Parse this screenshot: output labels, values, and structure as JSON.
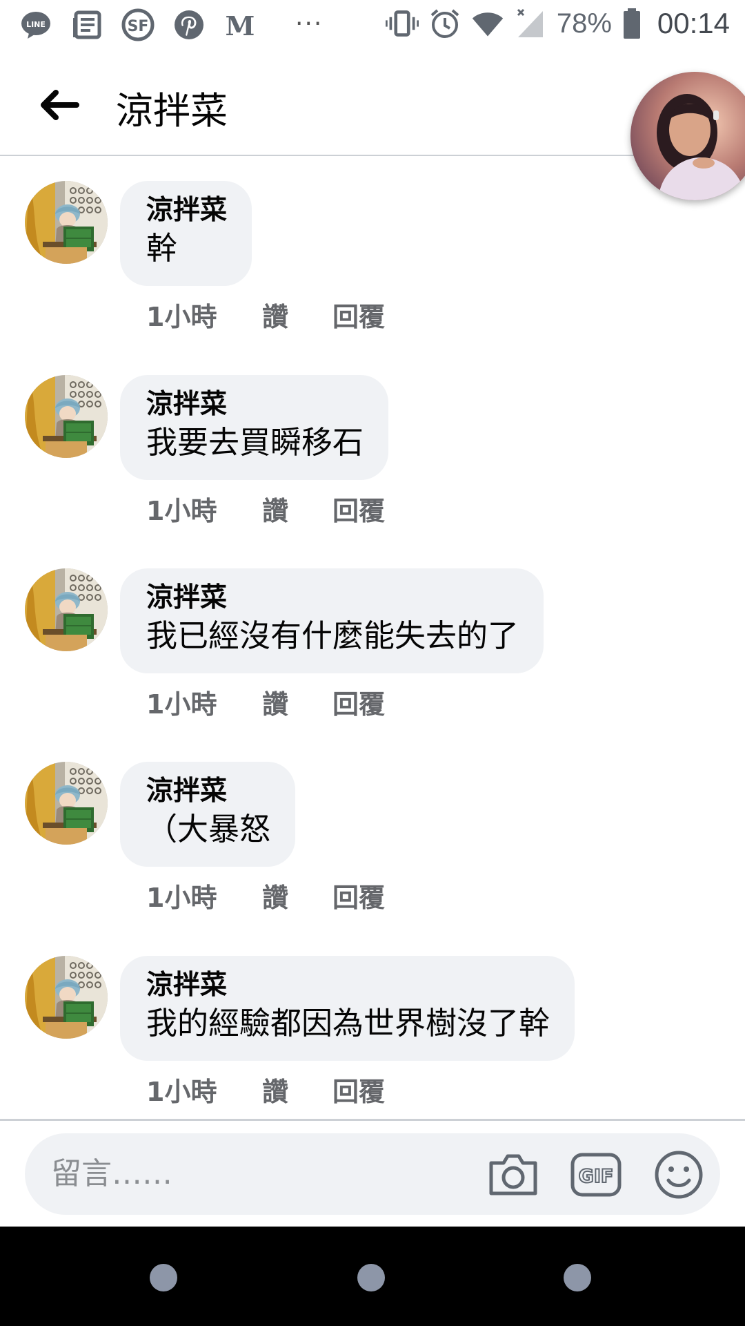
{
  "status_bar": {
    "left_icons": [
      "line-icon",
      "news-icon",
      "sf-icon",
      "pinterest-icon",
      "medium-icon"
    ],
    "line_icon_text": "LINE",
    "sf_icon_text": "SF",
    "medium_icon_text": "M",
    "more_dots": "···",
    "right_icons": [
      "vibrate-icon",
      "alarm-icon",
      "wifi-icon",
      "signal-icon",
      "battery-icon"
    ],
    "battery_percent": "78%",
    "time": "00:14"
  },
  "header": {
    "title": "涼拌菜",
    "back_icon": "arrow-left-icon"
  },
  "comments": [
    {
      "author": "涼拌菜",
      "text": "幹",
      "time": "1小時",
      "like": "讚",
      "reply": "回覆"
    },
    {
      "author": "涼拌菜",
      "text": "我要去買瞬移石",
      "time": "1小時",
      "like": "讚",
      "reply": "回覆"
    },
    {
      "author": "涼拌菜",
      "text": "我已經沒有什麼能失去的了",
      "time": "1小時",
      "like": "讚",
      "reply": "回覆"
    },
    {
      "author": "涼拌菜",
      "text": "（大暴怒",
      "time": "1小時",
      "like": "讚",
      "reply": "回覆"
    },
    {
      "author": "涼拌菜",
      "text": "我的經驗都因為世界樹沒了幹",
      "time": "1小時",
      "like": "讚",
      "reply": "回覆"
    }
  ],
  "composer": {
    "placeholder": "留言……",
    "buttons": [
      "camera-icon",
      "gif-icon",
      "smiley-icon"
    ],
    "gif_label": "GIF"
  },
  "colors": {
    "bubble": "#f0f2f5",
    "meta_text": "#65676b",
    "divider": "#ccd0d5",
    "nav_bar": "#000000"
  }
}
